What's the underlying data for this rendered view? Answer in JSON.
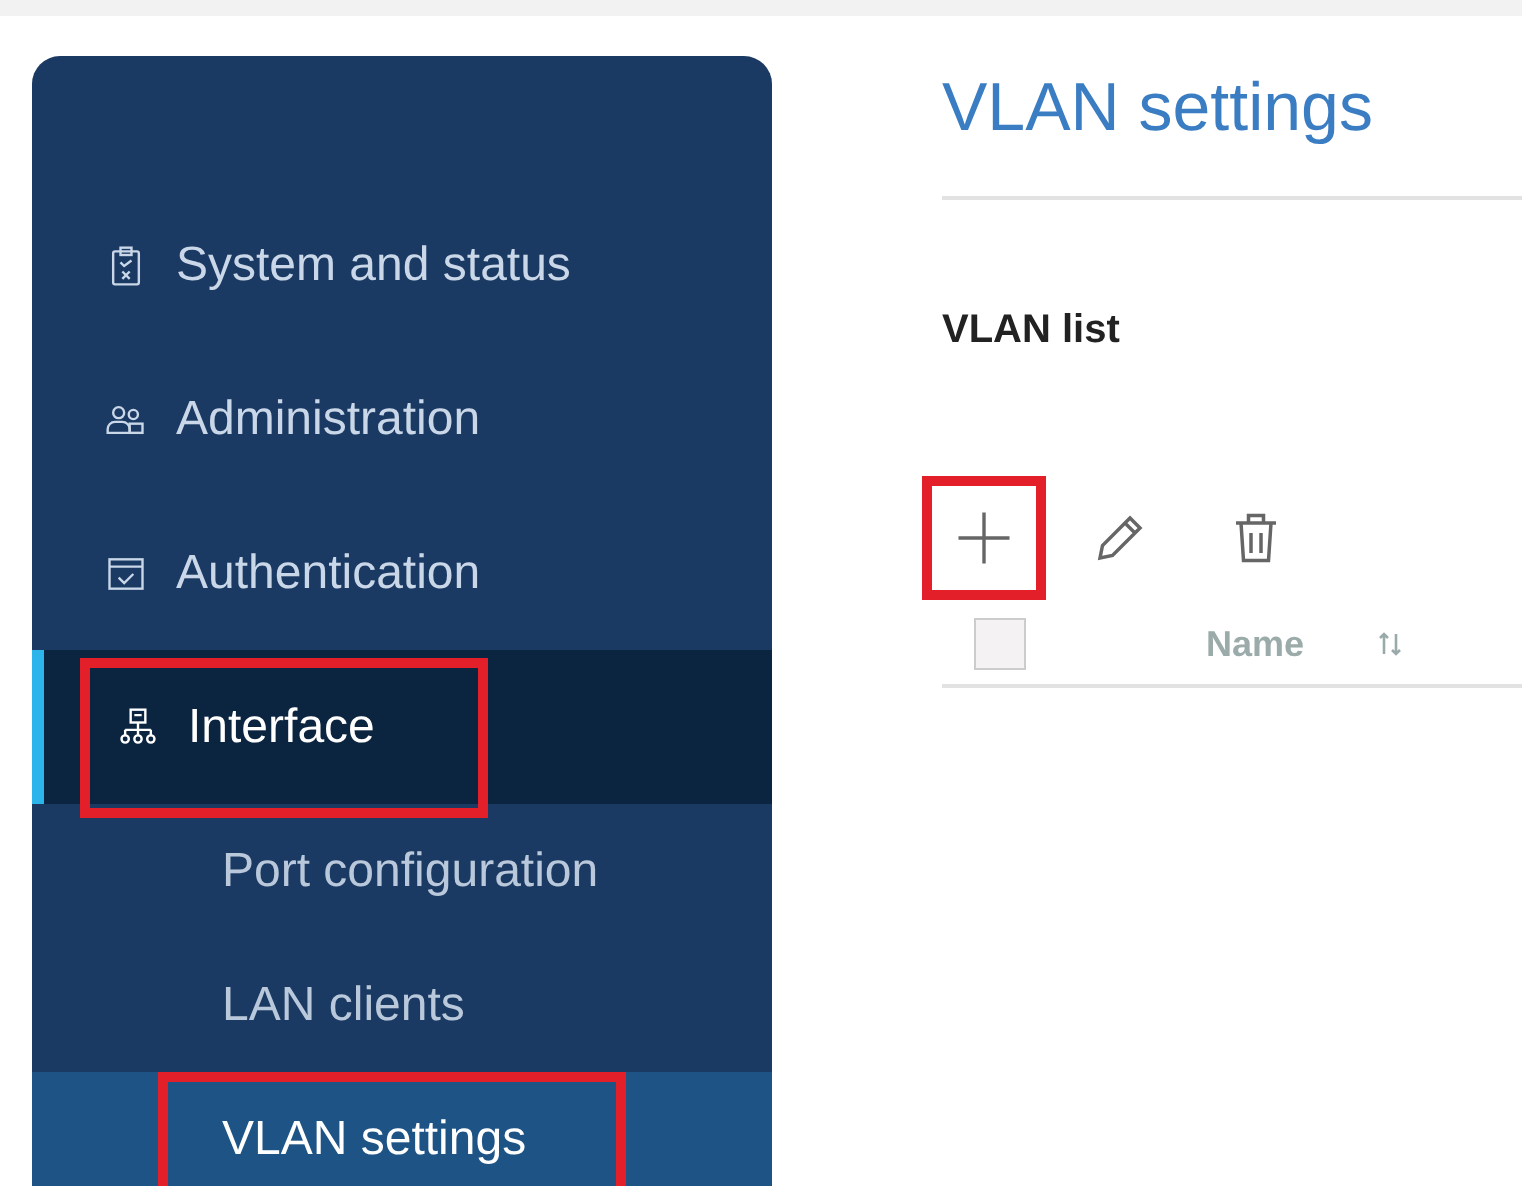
{
  "sidebar": {
    "items": [
      {
        "label": "System and status",
        "selected": false,
        "highlighted": false
      },
      {
        "label": "Administration",
        "selected": false,
        "highlighted": false
      },
      {
        "label": "Authentication",
        "selected": false,
        "highlighted": false
      },
      {
        "label": "Interface",
        "selected": true,
        "highlighted": true,
        "children": [
          {
            "label": "Port configuration",
            "selected": false,
            "highlighted": false
          },
          {
            "label": "LAN clients",
            "selected": false,
            "highlighted": false
          },
          {
            "label": "VLAN settings",
            "selected": true,
            "highlighted": true
          }
        ]
      }
    ]
  },
  "page": {
    "title": "VLAN settings",
    "section": "VLAN list",
    "toolbar": [
      {
        "kind": "add",
        "highlighted": true
      },
      {
        "kind": "edit",
        "highlighted": false
      },
      {
        "kind": "delete",
        "highlighted": false
      }
    ],
    "table": {
      "select_all": {
        "checked": false
      },
      "columns": [
        {
          "label": "Name",
          "sortable": true
        }
      ]
    }
  }
}
